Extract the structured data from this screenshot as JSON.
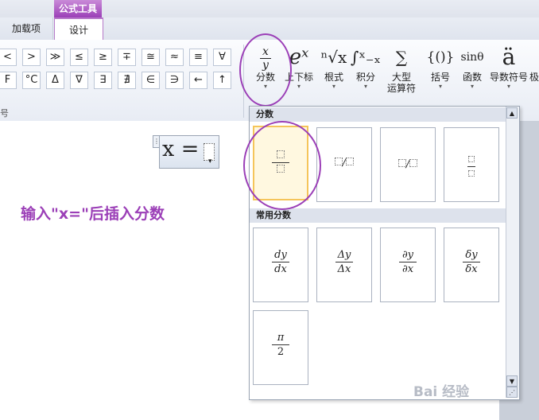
{
  "ribbon": {
    "context_tab": "公式工具",
    "tabs": [
      {
        "label": "加载项"
      },
      {
        "label": "设计"
      }
    ],
    "symbols_row1": [
      "<",
      ">",
      "≫",
      "≤",
      "≥",
      "∓",
      "≅",
      "≈",
      "≡",
      "∀"
    ],
    "symbols_row2": [
      "F",
      "°C",
      "Δ",
      "∇",
      "∃",
      "∄",
      "∈",
      "∋",
      "←",
      "↑"
    ],
    "group_label": "号",
    "big_buttons": [
      {
        "name": "fraction-button",
        "icon_top": "x",
        "icon_bottom": "y",
        "label": "分数"
      },
      {
        "name": "script-button",
        "icon": "eˣ",
        "label": "上下标"
      },
      {
        "name": "radical-button",
        "icon": "ⁿ√x",
        "label": "根式"
      },
      {
        "name": "integral-button",
        "icon": "∫ˣ₋ₓ",
        "label": "积分"
      },
      {
        "name": "large-operator-button",
        "icon": "∑",
        "label": "大型",
        "label2": "运算符"
      },
      {
        "name": "bracket-button",
        "icon": "{()}",
        "label": "括号"
      },
      {
        "name": "function-button",
        "icon": "sinθ",
        "label": "函数"
      },
      {
        "name": "accent-button",
        "icon": "ä",
        "label": "导数符号"
      },
      {
        "name": "limit-button",
        "icon": "",
        "label": "极"
      }
    ]
  },
  "document": {
    "equation": "x =",
    "instruction": "输入\"x=\"后插入分数"
  },
  "gallery": {
    "section1": "分数",
    "section2": "常用分数",
    "fraction_styles": [
      "stacked",
      "skewed",
      "linear",
      "small"
    ],
    "common_fractions": [
      {
        "num": "dy",
        "den": "dx"
      },
      {
        "num": "Δy",
        "den": "Δx"
      },
      {
        "num": "∂y",
        "den": "∂x"
      },
      {
        "num": "δy",
        "den": "δx"
      },
      {
        "num": "π",
        "den": "2"
      }
    ]
  },
  "watermark": "Bai 经验",
  "colors": {
    "accent": "#9b3fb7",
    "selection": "#f5c55a"
  }
}
